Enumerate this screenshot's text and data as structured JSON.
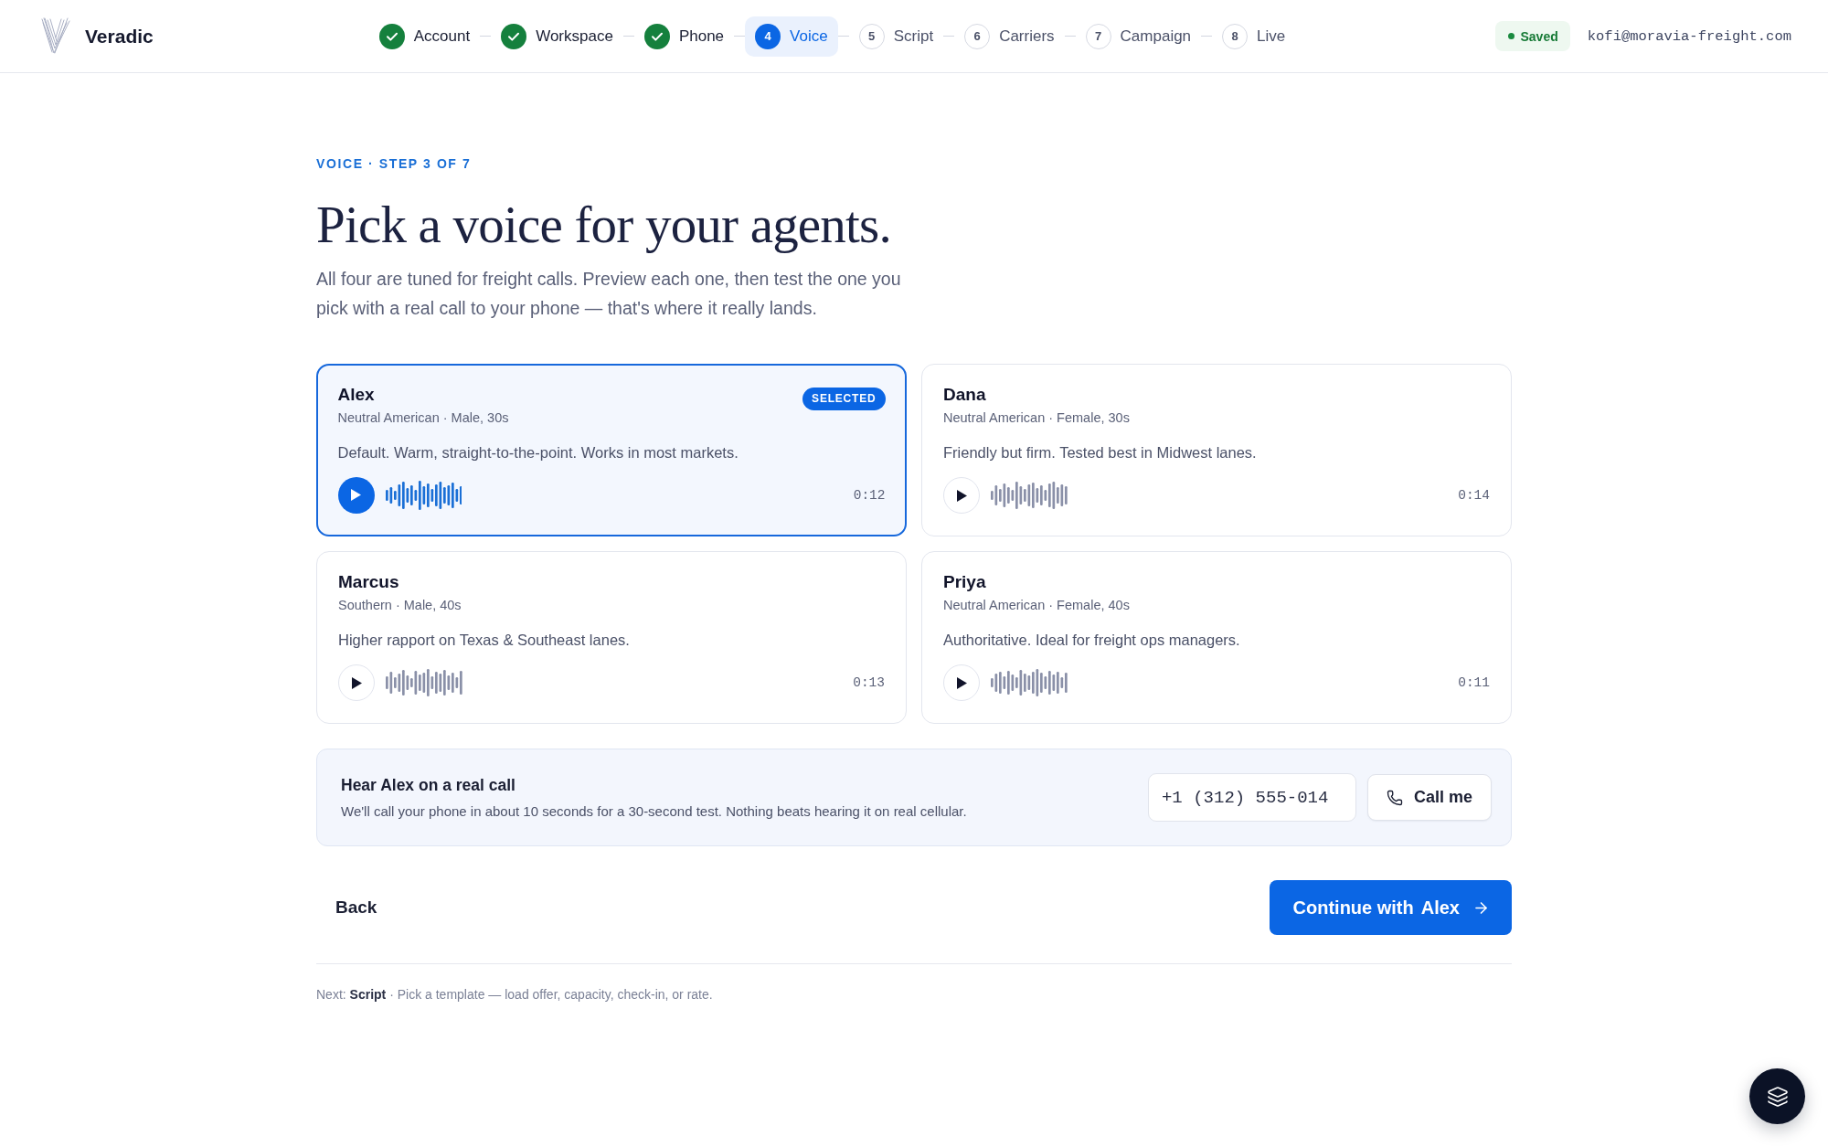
{
  "header": {
    "brand": "Veradic",
    "steps": [
      {
        "label": "Account",
        "completed": true,
        "selected": false
      },
      {
        "label": "Workspace",
        "completed": true,
        "selected": false
      },
      {
        "label": "Phone",
        "completed": true,
        "selected": false
      },
      {
        "number": "4",
        "label": "Voice",
        "completed": false,
        "selected": true
      },
      {
        "number": "5",
        "label": "Script",
        "completed": false,
        "selected": false
      },
      {
        "number": "6",
        "label": "Carriers",
        "completed": false,
        "selected": false
      },
      {
        "number": "7",
        "label": "Campaign",
        "completed": false,
        "selected": false
      },
      {
        "number": "8",
        "label": "Live",
        "completed": false,
        "selected": false
      }
    ],
    "saved": "Saved",
    "email": "kofi@moravia-freight.com"
  },
  "page": {
    "eyebrow": "VOICE · STEP 3 OF 7",
    "title": "Pick a voice for your agents.",
    "intro": "All four are tuned for freight calls. Preview each one, then test the one you pick with a real call to your phone — that's where it really lands."
  },
  "voices": [
    {
      "name": "Alex",
      "accent": "Neutral American · Male, 30s",
      "badge": "SELECTED",
      "description": "Default. Warm, straight-to-the-point. Works in most markets.",
      "duration": "0:12",
      "selected": true
    },
    {
      "name": "Dana",
      "accent": "Neutral American · Female, 30s",
      "description": "Friendly but firm. Tested best in Midwest lanes.",
      "duration": "0:14",
      "selected": false
    },
    {
      "name": "Marcus",
      "accent": "Southern · Male, 40s",
      "description": "Higher rapport on Texas & Southeast lanes.",
      "duration": "0:13",
      "selected": false
    },
    {
      "name": "Priya",
      "accent": "Neutral American · Female, 40s",
      "description": "Authoritative. Ideal for freight ops managers.",
      "duration": "0:11",
      "selected": false
    }
  ],
  "test_call": {
    "title": "Hear Alex on a real call",
    "description": "We'll call your phone in about 10 seconds for a 30-second test. Nothing beats hearing it on real cellular.",
    "phone_input": {
      "value": "+1 (312) 555-014"
    },
    "button": "Call me"
  },
  "actions": {
    "back": "Back",
    "continue": {
      "label": "Continue with",
      "voice": "Alex"
    }
  },
  "next_hint": "Next: **Script** · Pick a template — load offer, capacity, check-in, or rate."
}
